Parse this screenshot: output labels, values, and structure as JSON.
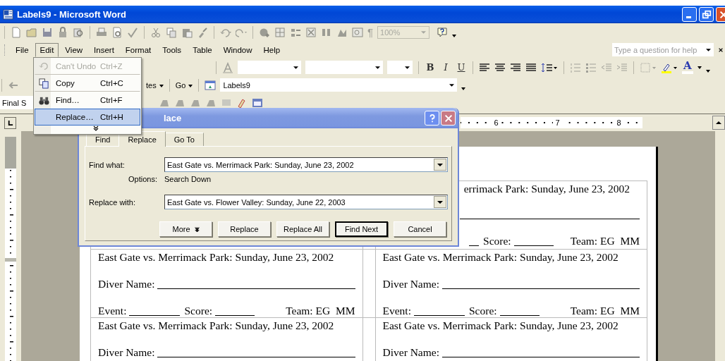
{
  "window": {
    "title": "Labels9 - Microsoft Word"
  },
  "standard_toolbar": {
    "zoom": "100%",
    "show_formatting": "¶"
  },
  "menu_bar": [
    {
      "label": "File",
      "selected": false
    },
    {
      "label": "Edit",
      "selected": true
    },
    {
      "label": "View",
      "selected": false
    },
    {
      "label": "Insert",
      "selected": false
    },
    {
      "label": "Format",
      "selected": false
    },
    {
      "label": "Tools",
      "selected": false
    },
    {
      "label": "Table",
      "selected": false
    },
    {
      "label": "Window",
      "selected": false
    },
    {
      "label": "Help",
      "selected": false
    }
  ],
  "help_box": {
    "placeholder": "Type a question for help"
  },
  "formatting_toolbar": {
    "style_buttons": [
      "B",
      "I",
      "U"
    ],
    "font_color": "A"
  },
  "web_toolbar": {
    "favorites": "tes",
    "go": "Go",
    "address": "Labels9"
  },
  "reviewing_toolbar": {
    "display": "Final S"
  },
  "ruler": {
    "numbers": [
      "6",
      "7",
      "8"
    ]
  },
  "edit_menu": [
    {
      "label": "Can't Undo",
      "shortcut": "Ctrl+Z",
      "disabled": true,
      "selected": false
    },
    {
      "label": "Copy",
      "shortcut": "Ctrl+C",
      "disabled": false,
      "selected": false
    },
    {
      "label": "Find…",
      "shortcut": "Ctrl+F",
      "disabled": false,
      "selected": false
    },
    {
      "label": "Replace…",
      "shortcut": "Ctrl+H",
      "disabled": false,
      "selected": true
    }
  ],
  "dialog": {
    "title": "lace",
    "tabs": [
      {
        "label": "Find",
        "selected": false
      },
      {
        "label": "Replace",
        "selected": true
      },
      {
        "label": "Go To",
        "selected": false
      }
    ],
    "find_label": "Find what:",
    "find_value": "East Gate vs. Merrimack Park: Sunday, June 23, 2002",
    "options_label": "Options:",
    "options_value": "Search Down",
    "replace_label": "Replace with:",
    "replace_value": "East Gate vs. Flower Valley: Sunday, June 22, 2003",
    "buttons": [
      {
        "label": "More",
        "kind": "more",
        "default": false
      },
      {
        "label": "Replace",
        "kind": "plain",
        "default": false
      },
      {
        "label": "Replace All",
        "kind": "plain",
        "default": false
      },
      {
        "label": "Find Next",
        "kind": "plain",
        "default": true
      },
      {
        "label": "Cancel",
        "kind": "plain",
        "default": false
      }
    ]
  },
  "labels": [
    {
      "cells": [
        {
          "kind": "covered"
        },
        {
          "kind": "partial",
          "heading": "errimack Park: Sunday, June 23, 2002",
          "score": "Score:",
          "team": "Team: EG  MM"
        }
      ]
    },
    {
      "cells": [
        {
          "kind": "full",
          "heading": "East Gate vs. Merrimack Park: Sunday, June 23, 2002",
          "diver": "Diver Name:",
          "event": "Event:",
          "score": "Score:",
          "team": "Team: EG  MM"
        },
        {
          "kind": "full",
          "heading": "East Gate vs. Merrimack Park: Sunday, June 23, 2002",
          "diver": "Diver Name:",
          "event": "Event:",
          "score": "Score:",
          "team": "Team: EG  MM"
        }
      ]
    },
    {
      "cells": [
        {
          "kind": "full",
          "heading": "East Gate vs. Merrimack Park: Sunday, June 23, 2002",
          "diver": "Diver Name:"
        },
        {
          "kind": "full",
          "heading": "East Gate vs. Merrimack Park: Sunday, June 23, 2002",
          "diver": "Diver Name:"
        }
      ]
    }
  ]
}
